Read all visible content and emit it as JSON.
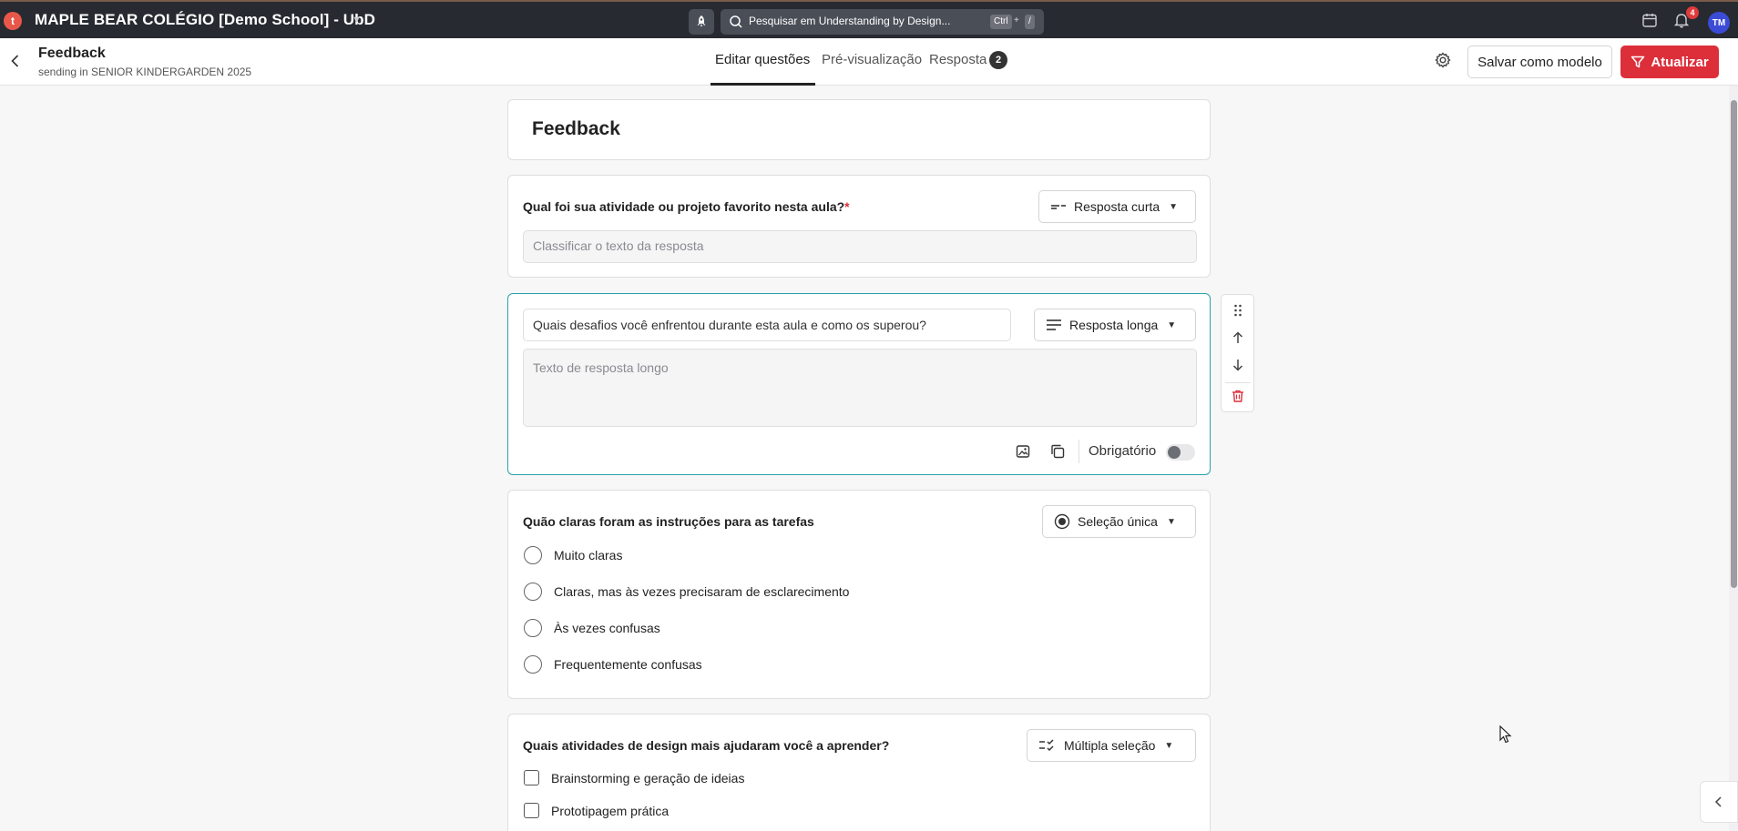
{
  "topbar": {
    "logo_glyph": "t",
    "school_name": "MAPLE BEAR COLÉGIO [Demo School] - UbD",
    "search_placeholder": "Pesquisar em Understanding by Design...",
    "shortcut_key1": "Ctrl",
    "shortcut_plus": "+",
    "shortcut_key2": "/",
    "notification_count": "4",
    "user_initials": "TM"
  },
  "header": {
    "title": "Feedback",
    "subtitle": "sending in SENIOR KINDERGARDEN 2025",
    "tabs": [
      {
        "label": "Editar questões"
      },
      {
        "label": "Pré-visualização"
      },
      {
        "label": "Resposta"
      }
    ],
    "response_count": "2",
    "save_template_label": "Salvar como modelo",
    "update_label": "Atualizar"
  },
  "form": {
    "title": "Feedback",
    "questions": [
      {
        "label": "Qual foi sua atividade ou projeto favorito nesta aula?",
        "required_mark": "*",
        "type": "Resposta curta",
        "answer_placeholder": "Classificar o texto da resposta"
      },
      {
        "label": "Quais desafios você enfrentou durante esta aula e como os superou?",
        "type": "Resposta longa",
        "answer_placeholder": "Texto de resposta longo",
        "required_label": "Obrigatório",
        "required": false
      },
      {
        "label": "Quão claras foram as instruções para as tarefas",
        "type": "Seleção única",
        "options": [
          "Muito claras",
          "Claras, mas às vezes precisaram de esclarecimento",
          "Às vezes confusas",
          "Frequentemente confusas"
        ]
      },
      {
        "label": "Quais atividades de design mais ajudaram você a aprender?",
        "type": "Múltipla seleção",
        "options": [
          "Brainstorming e geração de ideias",
          "Prototipagem prática"
        ]
      }
    ]
  },
  "colors": {
    "topbar_bg": "#272a30",
    "accent_red": "#dc2f3a",
    "selected_border": "#2aa3a8",
    "avatar_bg": "#3b4bd6"
  }
}
